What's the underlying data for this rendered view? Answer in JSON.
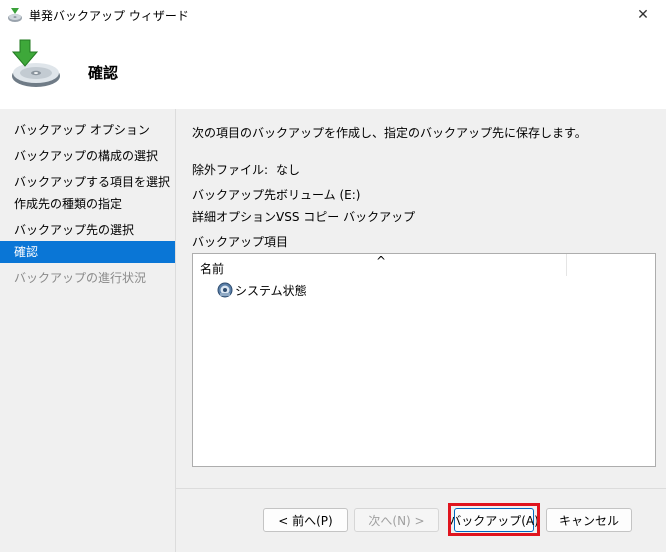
{
  "window": {
    "title": "単発バックアップ ウィザード",
    "close_symbol": "✕"
  },
  "header": {
    "title": "確認"
  },
  "sidebar": {
    "items": [
      {
        "label": "バックアップ オプション",
        "state": "normal"
      },
      {
        "label": "バックアップの構成の選択",
        "state": "normal"
      },
      {
        "label": "バックアップする項目を選択",
        "state": "normal"
      },
      {
        "label": "作成先の種類の指定",
        "state": "normal"
      },
      {
        "label": "バックアップ先の選択",
        "state": "normal"
      },
      {
        "label": "確認",
        "state": "active"
      },
      {
        "label": "バックアップの進行状況",
        "state": "disabled"
      }
    ]
  },
  "main": {
    "intro": "次の項目のバックアップを作成し、指定のバックアップ先に保存します。",
    "info": [
      {
        "label": "除外ファイル:",
        "value": "なし"
      },
      {
        "label": "バックアップ先:",
        "value": "ボリューム (E:)"
      },
      {
        "label": "詳細オプション:",
        "value": "VSS コピー バックアップ"
      }
    ],
    "items_label": "バックアップ項目",
    "list": {
      "column_name": "名前",
      "sort_indicator": "^",
      "rows": [
        {
          "label": "システム状態",
          "icon": "system-state-icon"
        }
      ]
    }
  },
  "footer": {
    "prev_label": "< 前へ(P)",
    "next_label": "次へ(N) >",
    "backup_label": "バックアップ(A)",
    "cancel_label": "キャンセル"
  },
  "colors": {
    "accent": "#0a76d6",
    "highlight": "#e0141e"
  }
}
